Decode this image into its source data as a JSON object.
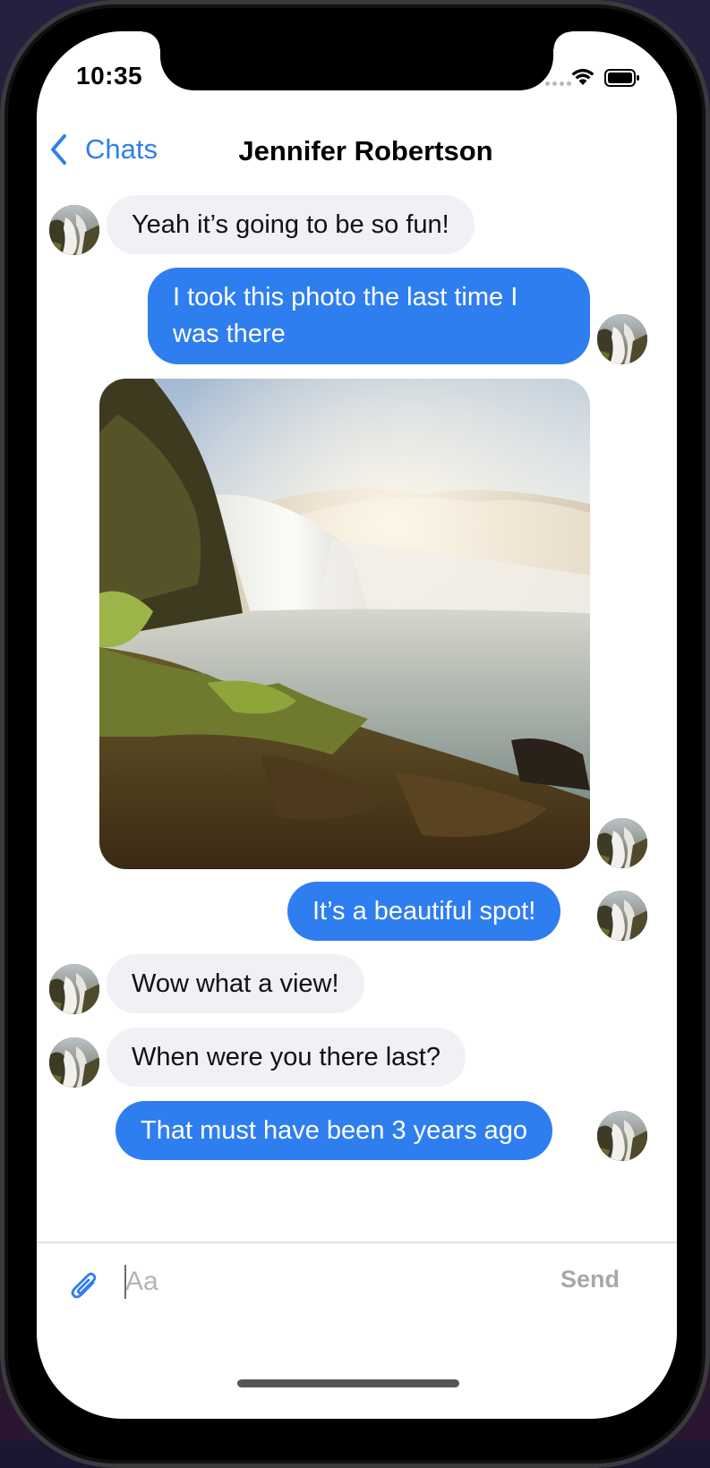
{
  "status_bar": {
    "time": "10:35",
    "icons": [
      "cellular-dots-icon",
      "wifi-icon",
      "battery-icon"
    ]
  },
  "nav": {
    "back_label": "Chats",
    "title": "Jennifer Robertson"
  },
  "colors": {
    "accent": "#2f7ef0",
    "incoming_bubble": "#f0f0f5",
    "outgoing_text": "#ffffff"
  },
  "messages": [
    {
      "direction": "incoming",
      "type": "text",
      "text": "Yeah it’s going to be so fun!"
    },
    {
      "direction": "outgoing",
      "type": "text",
      "text": "I took this photo the last time I was there"
    },
    {
      "direction": "outgoing",
      "type": "image",
      "image": "waterfall-landscape-photo"
    },
    {
      "direction": "outgoing",
      "type": "text",
      "text": "It’s a beautiful spot!"
    },
    {
      "direction": "incoming",
      "type": "text",
      "text": "Wow what a view!"
    },
    {
      "direction": "incoming",
      "type": "text",
      "text": "When were you there last?"
    },
    {
      "direction": "outgoing",
      "type": "text",
      "text": "That must have been 3 years ago"
    }
  ],
  "composer": {
    "attach_icon": "paperclip-icon",
    "placeholder": "Aa",
    "value": "",
    "send_label": "Send"
  }
}
